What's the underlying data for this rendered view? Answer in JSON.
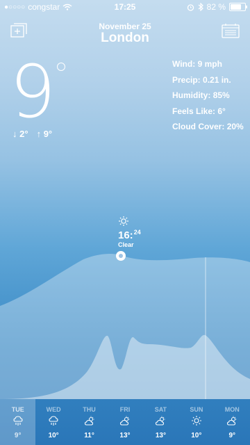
{
  "status": {
    "carrier": "congstar",
    "time": "17:25",
    "battery_text": "82 %",
    "battery_level": 0.82
  },
  "header": {
    "date": "November 25",
    "city": "London"
  },
  "current": {
    "temp": "9",
    "low": "2°",
    "high": "9°"
  },
  "details": [
    {
      "label": "Wind:",
      "value": "9 mph"
    },
    {
      "label": "Precip:",
      "value": "0.21 in."
    },
    {
      "label": "Humidity:",
      "value": "85%"
    },
    {
      "label": "Feels Like:",
      "value": "6°"
    },
    {
      "label": "Cloud Cover:",
      "value": "20%"
    }
  ],
  "marker": {
    "hour": "16:",
    "minute": "24",
    "condition": "Clear"
  },
  "forecast": [
    {
      "day": "TUE",
      "temp": "9°",
      "icon": "rain-cloud-icon"
    },
    {
      "day": "WED",
      "temp": "10°",
      "icon": "rain-cloud-icon"
    },
    {
      "day": "THU",
      "temp": "11°",
      "icon": "partly-cloudy-icon"
    },
    {
      "day": "FRI",
      "temp": "13°",
      "icon": "partly-cloudy-icon"
    },
    {
      "day": "SAT",
      "temp": "13°",
      "icon": "partly-cloudy-icon"
    },
    {
      "day": "SUN",
      "temp": "10°",
      "icon": "sun-icon"
    },
    {
      "day": "MON",
      "temp": "9°",
      "icon": "partly-cloudy-icon"
    }
  ]
}
